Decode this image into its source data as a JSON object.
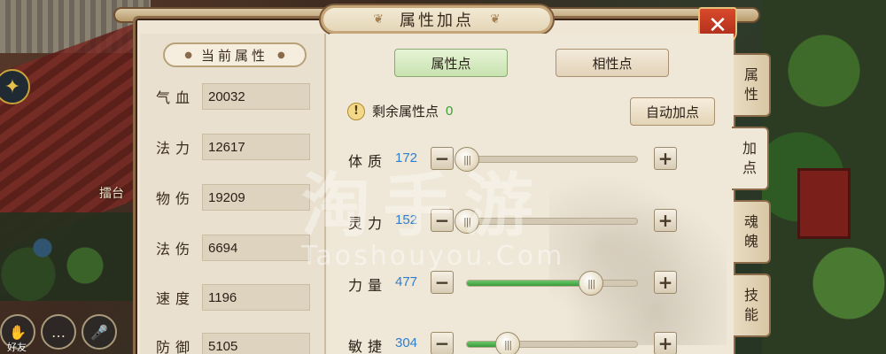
{
  "background": {
    "arena_label": "擂台",
    "friend_label": "好友"
  },
  "window": {
    "title": "属性加点"
  },
  "left": {
    "header": "当前属性",
    "attributes": [
      {
        "label": "气血",
        "value": "20032"
      },
      {
        "label": "法力",
        "value": "12617"
      },
      {
        "label": "物伤",
        "value": "19209"
      },
      {
        "label": "法伤",
        "value": "6694"
      },
      {
        "label": "速度",
        "value": "1196"
      },
      {
        "label": "防御",
        "value": "5105"
      }
    ]
  },
  "tabs": {
    "attr_points": "属性点",
    "xiang_points": "相性点"
  },
  "remaining": {
    "label": "剩余属性点",
    "value": "0"
  },
  "auto_button": "自动加点",
  "sliders": [
    {
      "label": "体质",
      "value": "172",
      "level": 0.0
    },
    {
      "label": "灵力",
      "value": "152",
      "level": 0.0
    },
    {
      "label": "力量",
      "value": "477",
      "level": 0.73
    },
    {
      "label": "敏捷",
      "value": "304",
      "level": 0.24
    }
  ],
  "side_tabs": [
    {
      "label": "属性",
      "active": false
    },
    {
      "label": "加点",
      "active": true
    },
    {
      "label": "魂魄",
      "active": false
    },
    {
      "label": "技能",
      "active": false
    }
  ],
  "watermark": {
    "main": "淘手游",
    "sub": "Taoshouyou.Com"
  },
  "colors": {
    "accent_green": "#3aa030",
    "value_blue": "#2f7fd0",
    "close_red": "#c83a22"
  }
}
